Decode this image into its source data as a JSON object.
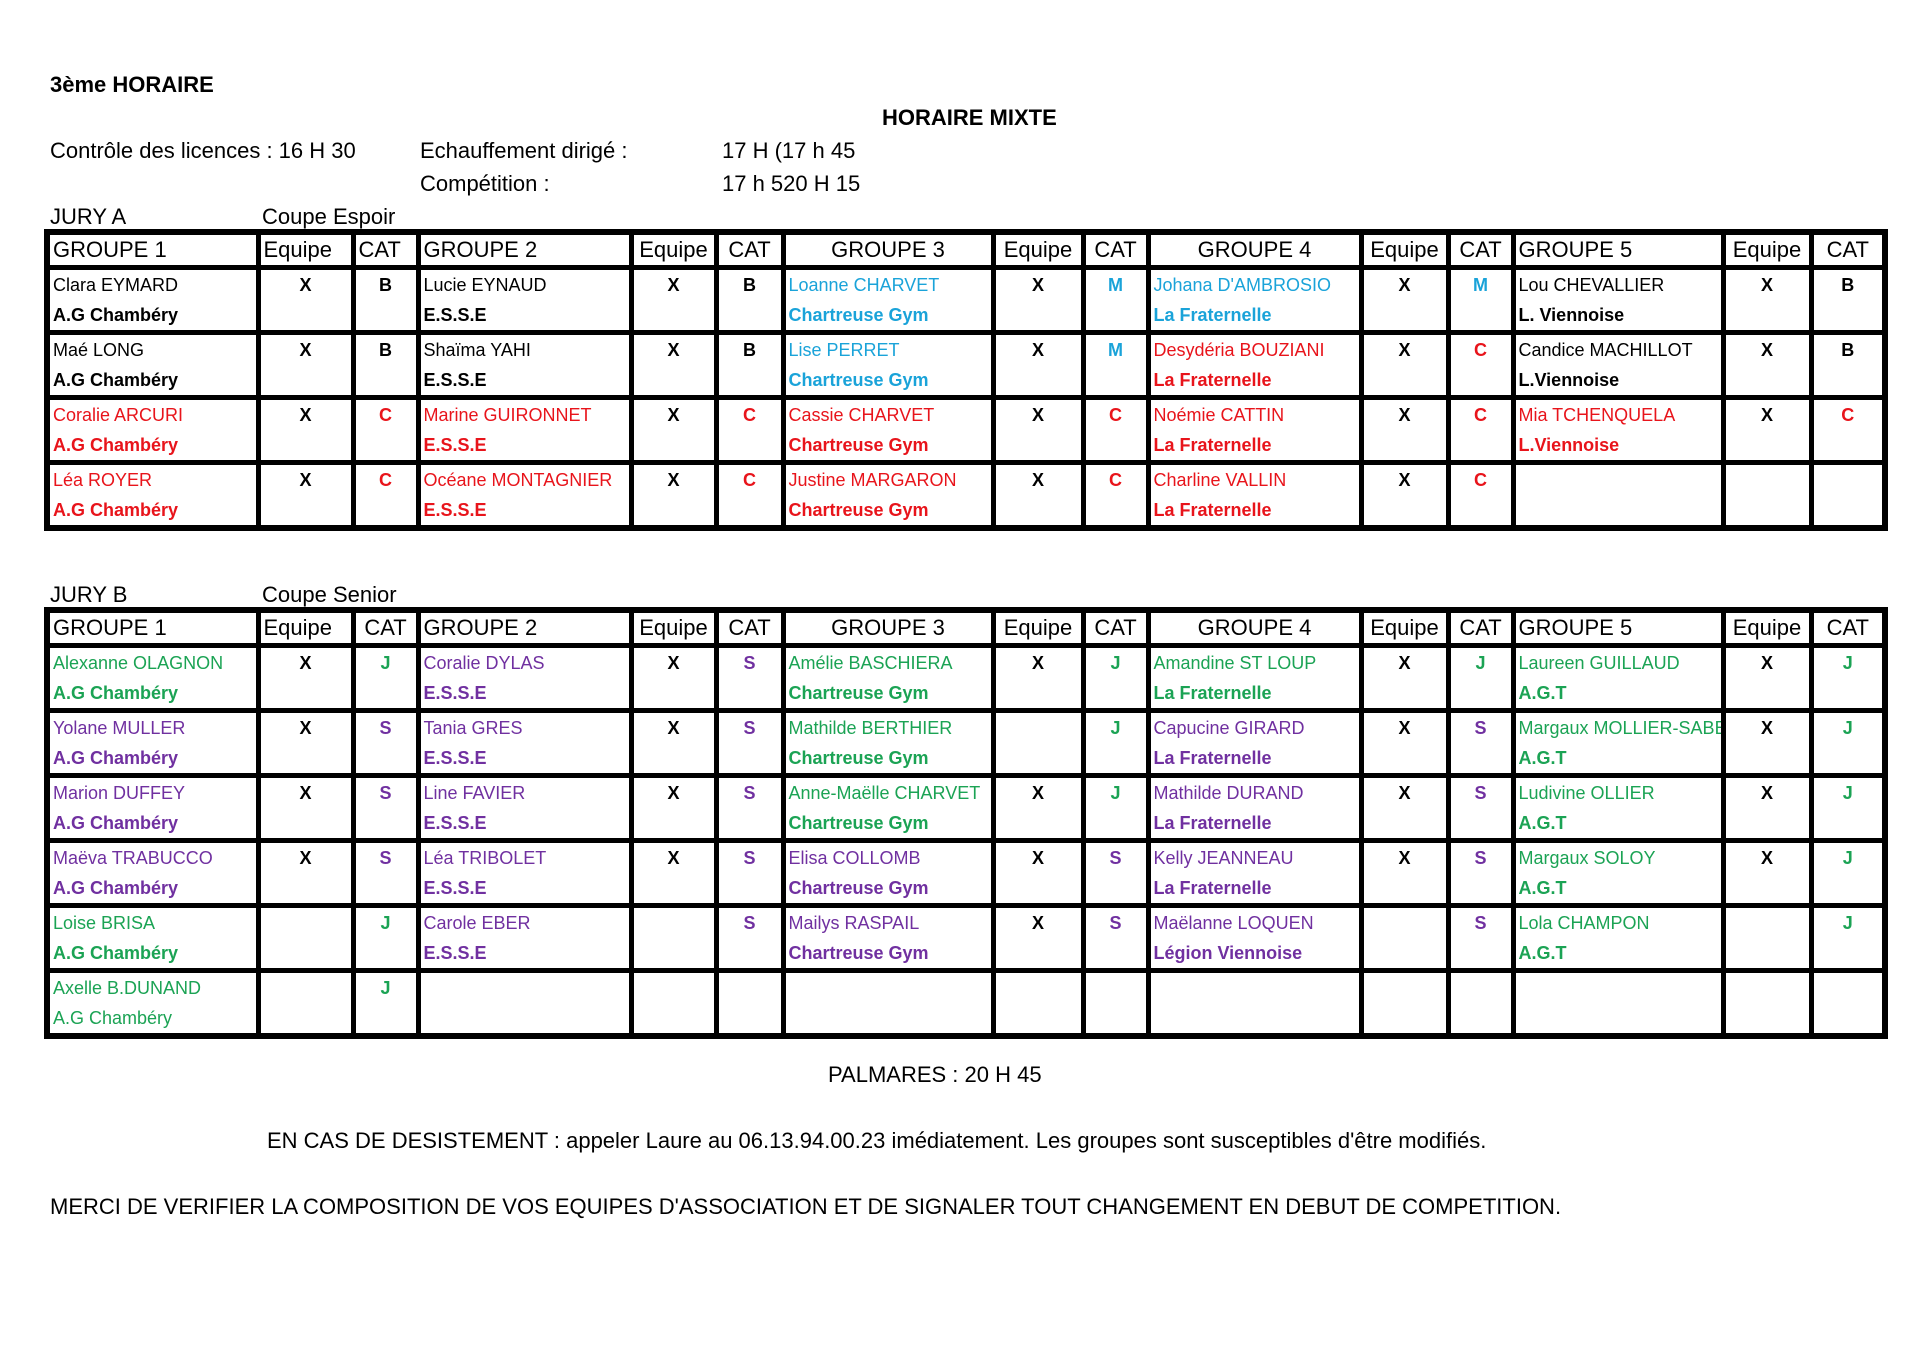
{
  "header": {
    "title": "3ème HORAIRE",
    "subtitle": "HORAIRE MIXTE",
    "controle_label": "Contrôle des licences : 16 H 30",
    "echauffement_label": "Echauffement dirigé :",
    "echauffement_time": "17 H (17 h 45",
    "competition_label": "Compétition :",
    "competition_time": "17 h 520 H 15"
  },
  "headers": {
    "g1": "GROUPE 1",
    "g2": "GROUPE 2",
    "g3": "GROUPE 3",
    "g4": "GROUPE 4",
    "g5": "GROUPE 5",
    "equipe": "Equipe",
    "cat": "CAT"
  },
  "colors": {
    "black": "#000000",
    "red": "#e8141b",
    "cyan": "#1aa3d9",
    "green": "#1ba354",
    "purple": "#7030a0"
  },
  "jury_a": {
    "label": "JURY A",
    "cup": "Coupe Espoir",
    "rows": [
      [
        {
          "name": "Clara EYMARD",
          "club": "A.G Chambéry",
          "equipe": "X",
          "cat": "B",
          "color": "black"
        },
        {
          "name": "Lucie EYNAUD",
          "club": "E.S.S.E",
          "equipe": "X",
          "cat": "B",
          "color": "black"
        },
        {
          "name": "Loanne  CHARVET",
          "club": "Chartreuse Gym",
          "equipe": "X",
          "cat": "M",
          "color": "cyan"
        },
        {
          "name": "Johana D'AMBROSIO",
          "club": "La Fraternelle",
          "equipe": "X",
          "cat": "M",
          "color": "cyan"
        },
        {
          "name": "Lou CHEVALLIER",
          "club": "L. Viennoise",
          "equipe": "X",
          "cat": "B",
          "color": "black"
        }
      ],
      [
        {
          "name": "Maé LONG",
          "club": "A.G Chambéry",
          "equipe": "X",
          "cat": "B",
          "color": "black"
        },
        {
          "name": "Shaïma YAHI",
          "club": "E.S.S.E",
          "equipe": "X",
          "cat": "B",
          "color": "black"
        },
        {
          "name": "Lise PERRET",
          "club": "Chartreuse Gym",
          "equipe": "X",
          "cat": "M",
          "color": "cyan"
        },
        {
          "name": "Desydéria BOUZIANI",
          "club": "La Fraternelle",
          "equipe": "X",
          "cat": "C",
          "color": "red"
        },
        {
          "name": "Candice MACHILLOT",
          "club": "L.Viennoise",
          "equipe": "X",
          "cat": "B",
          "color": "black"
        }
      ],
      [
        {
          "name": "Coralie ARCURI",
          "club": "A.G Chambéry",
          "equipe": "X",
          "cat": "C",
          "color": "red"
        },
        {
          "name": "Marine GUIRONNET",
          "club": "E.S.S.E",
          "equipe": "X",
          "cat": "C",
          "color": "red"
        },
        {
          "name": "Cassie  CHARVET",
          "club": "Chartreuse Gym",
          "equipe": "X",
          "cat": "C",
          "color": "red"
        },
        {
          "name": "Noémie CATTIN",
          "club": "La Fraternelle",
          "equipe": "X",
          "cat": "C",
          "color": "red"
        },
        {
          "name": "Mia TCHENQUELA",
          "club": "L.Viennoise",
          "equipe": "X",
          "cat": "C",
          "color": "red"
        }
      ],
      [
        {
          "name": "Léa ROYER",
          "club": "A.G Chambéry",
          "equipe": "X",
          "cat": "C",
          "color": "red"
        },
        {
          "name": "Océane MONTAGNIER",
          "club": "E.S.S.E",
          "equipe": "X",
          "cat": "C",
          "color": "red"
        },
        {
          "name": "Justine MARGARON",
          "club": "Chartreuse Gym",
          "equipe": "X",
          "cat": "C",
          "color": "red"
        },
        {
          "name": "Charline VALLIN",
          "club": "La Fraternelle",
          "equipe": "X",
          "cat": "C",
          "color": "red"
        },
        {
          "name": "",
          "club": "",
          "equipe": "",
          "cat": "",
          "color": "black"
        }
      ]
    ]
  },
  "jury_b": {
    "label": "JURY B",
    "cup": "Coupe Senior",
    "rows": [
      [
        {
          "name": "Alexanne OLAGNON",
          "club": "A.G Chambéry",
          "equipe": "X",
          "cat": "J",
          "color": "green"
        },
        {
          "name": "Coralie DYLAS",
          "club": "E.S.S.E",
          "equipe": "X",
          "cat": "S",
          "color": "purple"
        },
        {
          "name": "Amélie BASCHIERA",
          "club": "Chartreuse Gym",
          "equipe": "X",
          "cat": "J",
          "color": "green"
        },
        {
          "name": "Amandine ST LOUP",
          "club": "La Fraternelle",
          "equipe": "X",
          "cat": "J",
          "color": "green"
        },
        {
          "name": "Laureen GUILLAUD",
          "club": "A.G.T",
          "equipe": "X",
          "cat": "J",
          "color": "green"
        }
      ],
      [
        {
          "name": "Yolane MULLER",
          "club": "A.G Chambéry",
          "equipe": "X",
          "cat": "S",
          "color": "purple"
        },
        {
          "name": "Tania GRES",
          "club": "E.S.S.E",
          "equipe": "X",
          "cat": "S",
          "color": "purple"
        },
        {
          "name": "Mathilde BERTHIER",
          "club": "Chartreuse Gym",
          "equipe": "",
          "cat": "J",
          "color": "green"
        },
        {
          "name": "Capucine GIRARD",
          "club": "La Fraternelle",
          "equipe": "X",
          "cat": "S",
          "color": "purple"
        },
        {
          "name": "Margaux MOLLIER-SABET",
          "club": "A.G.T",
          "equipe": "X",
          "cat": "J",
          "color": "green"
        }
      ],
      [
        {
          "name": "Marion DUFFEY",
          "club": "A.G Chambéry",
          "equipe": "X",
          "cat": "S",
          "color": "purple"
        },
        {
          "name": "Line FAVIER",
          "club": "E.S.S.E",
          "equipe": "X",
          "cat": "S",
          "color": "purple"
        },
        {
          "name": "Anne-Maëlle CHARVET",
          "club": "Chartreuse Gym",
          "equipe": "X",
          "cat": "J",
          "color": "green"
        },
        {
          "name": "Mathilde DURAND",
          "club": "La Fraternelle",
          "equipe": "X",
          "cat": "S",
          "color": "purple"
        },
        {
          "name": "Ludivine OLLIER",
          "club": "A.G.T",
          "equipe": "X",
          "cat": "J",
          "color": "green"
        }
      ],
      [
        {
          "name": "Maëva TRABUCCO",
          "club": "A.G Chambéry",
          "equipe": "X",
          "cat": "S",
          "color": "purple"
        },
        {
          "name": "Léa TRIBOLET",
          "club": "E.S.S.E",
          "equipe": "X",
          "cat": "S",
          "color": "purple"
        },
        {
          "name": "Elisa COLLOMB",
          "club": "Chartreuse Gym",
          "equipe": "X",
          "cat": "S",
          "color": "purple"
        },
        {
          "name": "Kelly JEANNEAU",
          "club": "La Fraternelle",
          "equipe": "X",
          "cat": "S",
          "color": "purple"
        },
        {
          "name": "Margaux SOLOY",
          "club": "A.G.T",
          "equipe": "X",
          "cat": "J",
          "color": "green"
        }
      ],
      [
        {
          "name": "Loise BRISA",
          "club": "A.G Chambéry",
          "equipe": "",
          "cat": "J",
          "color": "green"
        },
        {
          "name": "Carole EBER",
          "club": "E.S.S.E",
          "equipe": "",
          "cat": "S",
          "color": "purple"
        },
        {
          "name": "Mailys RASPAIL",
          "club": "Chartreuse Gym",
          "equipe": "X",
          "cat": "S",
          "color": "purple"
        },
        {
          "name": "Maëlanne LOQUEN",
          "club": "Légion Viennoise",
          "equipe": "",
          "cat": "S",
          "color": "purple"
        },
        {
          "name": "Lola CHAMPON",
          "club": "A.G.T",
          "equipe": "",
          "cat": "J",
          "color": "green"
        }
      ],
      [
        {
          "name": "Axelle B.DUNAND",
          "club": "A.G Chambéry",
          "club_bold": false,
          "equipe": "",
          "cat": "J",
          "color": "green"
        },
        {
          "name": "",
          "club": "",
          "equipe": "",
          "cat": "",
          "color": "black"
        },
        {
          "name": "",
          "club": "",
          "equipe": "",
          "cat": "",
          "color": "black"
        },
        {
          "name": "",
          "club": "",
          "equipe": "",
          "cat": "",
          "color": "black"
        },
        {
          "name": "",
          "club": "",
          "equipe": "",
          "cat": "",
          "color": "black"
        }
      ]
    ]
  },
  "footer": {
    "palmares": "PALMARES : 20 H 45",
    "desistement": "EN CAS DE DESISTEMENT : appeler Laure  au 06.13.94.00.23 imédiatement. Les groupes sont susceptibles d'être modifiés.",
    "merci": "MERCI DE VERIFIER LA COMPOSITION DE VOS EQUIPES D'ASSOCIATION  ET DE SIGNALER TOUT CHANGEMENT EN DEBUT DE COMPETITION."
  }
}
